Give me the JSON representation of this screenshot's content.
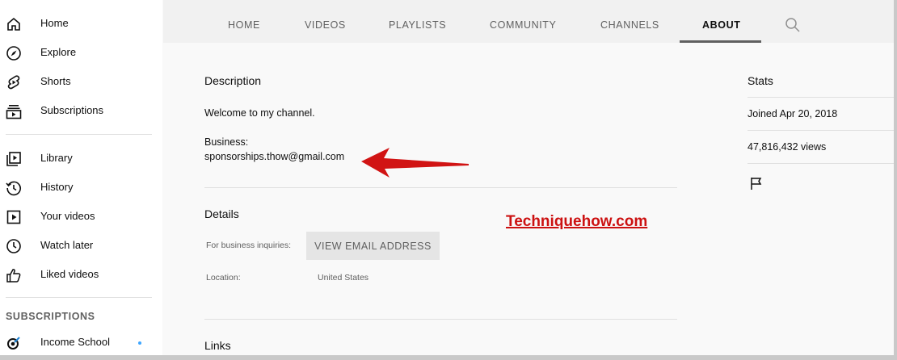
{
  "sidebar": {
    "items": [
      {
        "label": "Home",
        "icon": "home-icon"
      },
      {
        "label": "Explore",
        "icon": "compass-icon"
      },
      {
        "label": "Shorts",
        "icon": "shorts-icon"
      },
      {
        "label": "Subscriptions",
        "icon": "subscriptions-icon"
      },
      {
        "label": "Library",
        "icon": "library-icon"
      },
      {
        "label": "History",
        "icon": "history-icon"
      },
      {
        "label": "Your videos",
        "icon": "play-icon"
      },
      {
        "label": "Watch later",
        "icon": "clock-icon"
      },
      {
        "label": "Liked videos",
        "icon": "thumbs-up-icon"
      }
    ],
    "section_title": "SUBSCRIPTIONS",
    "subscriptions": [
      {
        "label": "Income School",
        "icon": "income-school-icon",
        "has_new": true
      }
    ]
  },
  "tabs": [
    {
      "label": "HOME",
      "active": false
    },
    {
      "label": "VIDEOS",
      "active": false
    },
    {
      "label": "PLAYLISTS",
      "active": false
    },
    {
      "label": "COMMUNITY",
      "active": false
    },
    {
      "label": "CHANNELS",
      "active": false
    },
    {
      "label": "ABOUT",
      "active": true
    }
  ],
  "description": {
    "title": "Description",
    "text": "Welcome to my channel.",
    "business_label": "Business:",
    "business_email": "sponsorships.thow@gmail.com"
  },
  "details": {
    "title": "Details",
    "business_inquiries_label": "For business inquiries:",
    "view_email_label": "VIEW EMAIL ADDRESS",
    "location_label": "Location:",
    "location_value": "United States"
  },
  "links": {
    "title": "Links"
  },
  "stats": {
    "title": "Stats",
    "joined": "Joined Apr 20, 2018",
    "views": "47,816,432 views"
  },
  "watermark": "Techniquehow.com",
  "colors": {
    "accent_red": "#cc1111",
    "new_dot": "#3ea6ff"
  }
}
